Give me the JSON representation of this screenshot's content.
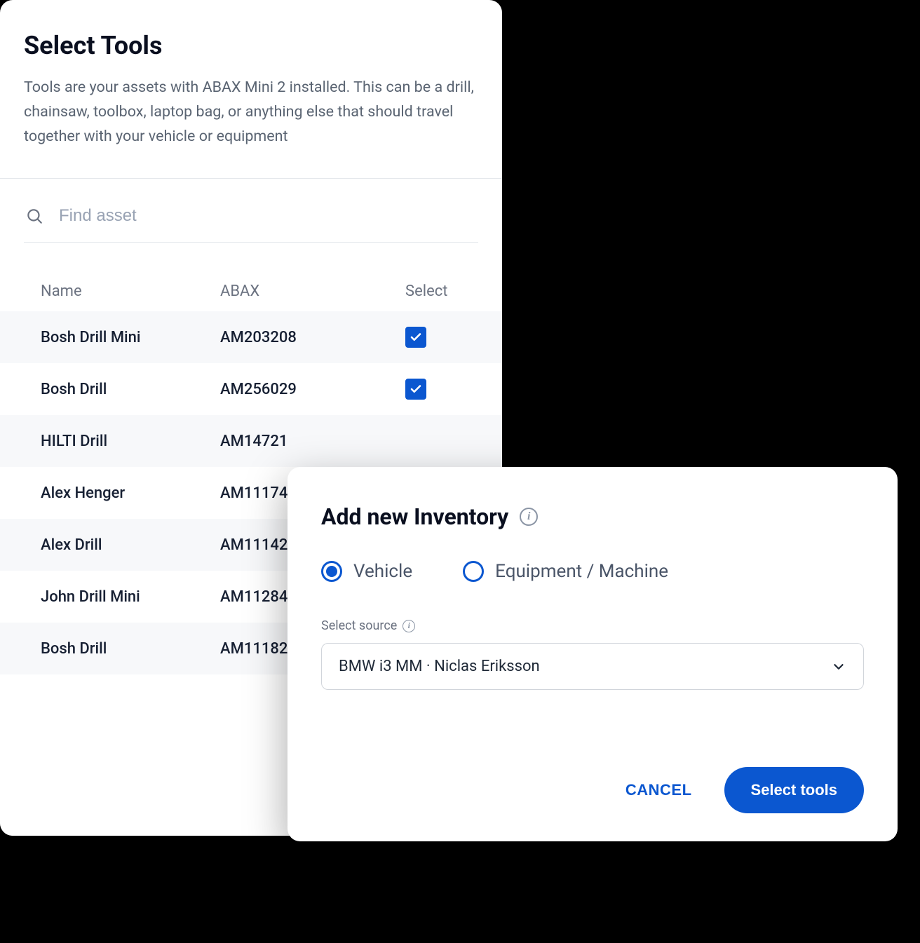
{
  "tools": {
    "title": "Select Tools",
    "description": "Tools are your assets with ABAX Mini 2 installed. This can be a drill, chainsaw, toolbox, laptop bag, or anything else that should travel together with your vehicle or equipment",
    "search_placeholder": "Find asset",
    "columns": {
      "name": "Name",
      "abax": "ABAX",
      "select": "Select"
    },
    "rows": [
      {
        "name": "Bosh Drill Mini",
        "abax": "AM203208",
        "checked": true,
        "checkbox": true
      },
      {
        "name": "Bosh Drill",
        "abax": "AM256029",
        "checked": true,
        "checkbox": true
      },
      {
        "name": "HILTI Drill",
        "abax": "AM14721",
        "checked": false,
        "checkbox": false
      },
      {
        "name": "Alex Henger",
        "abax": "AM11174",
        "checked": false,
        "checkbox": false
      },
      {
        "name": "Alex Drill",
        "abax": "AM11142",
        "checked": false,
        "checkbox": false
      },
      {
        "name": "John Drill Mini",
        "abax": "AM11284",
        "checked": false,
        "checkbox": false
      },
      {
        "name": "Bosh Drill",
        "abax": "AM11182",
        "checked": false,
        "checkbox": false
      }
    ]
  },
  "modal": {
    "title": "Add new Inventory",
    "options": {
      "vehicle": "Vehicle",
      "equipment": "Equipment / Machine"
    },
    "selected": "vehicle",
    "source_label": "Select source",
    "source_value": "BMW i3 MM · Niclas Eriksson",
    "cancel": "CANCEL",
    "submit": "Select tools"
  }
}
